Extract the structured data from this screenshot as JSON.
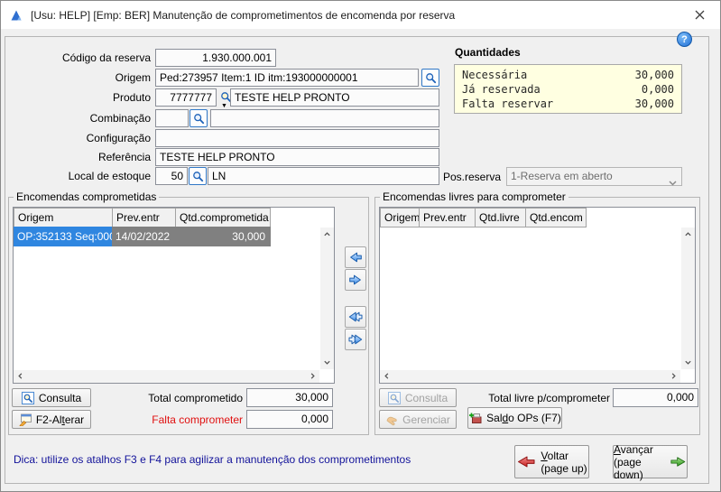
{
  "window": {
    "title": "[Usu: HELP] [Emp: BER] Manutenção de comprometimentos de encomenda por reserva",
    "help_glyph": "?"
  },
  "form": {
    "codigo": {
      "label": "Código da reserva",
      "value": "1.930.000.001"
    },
    "origem": {
      "label": "Origem",
      "value": "Ped:273957 Item:1 ID itm:193000000001"
    },
    "produto": {
      "label": "Produto",
      "code": "7777777",
      "desc": "TESTE HELP PRONTO",
      "dropdown_glyph": "▼"
    },
    "combinacao": {
      "label": "Combinação",
      "code": "",
      "desc": ""
    },
    "configuracao": {
      "label": "Configuração",
      "value": ""
    },
    "referencia": {
      "label": "Referência",
      "value": "TESTE HELP PRONTO"
    },
    "local": {
      "label": "Local de estoque",
      "code": "50",
      "desc": "LN"
    },
    "pos_reserva": {
      "label": "Pos.reserva",
      "value": "1-Reserva em aberto"
    }
  },
  "quantidades": {
    "title": "Quantidades",
    "rows": [
      {
        "label": "Necessária",
        "value": "30,000"
      },
      {
        "label": "Já reservada",
        "value": "0,000"
      },
      {
        "label": "Falta reservar",
        "value": "30,000"
      }
    ]
  },
  "committed": {
    "title": "Encomendas comprometidas",
    "columns": [
      "Origem",
      "Prev.entr",
      "Qtd.comprometida"
    ],
    "row": {
      "origem": "OP:352133 Seq:000",
      "prev_entr": "14/02/2022",
      "qtd": "30,000"
    },
    "consulta": "Consulta",
    "alterar": "F2-Alterar",
    "total_label": "Total comprometido",
    "total_value": "30,000",
    "falta_label": "Falta comprometer",
    "falta_value": "0,000"
  },
  "free": {
    "title": "Encomendas livres para comprometer",
    "columns": [
      "Origem",
      "Prev.entr",
      "Qtd.livre",
      "Qtd.encom"
    ],
    "consulta": "Consulta",
    "gerenciar": "Gerenciar",
    "saldo_ops": "Saldo OPs (F7)",
    "total_label": "Total livre p/comprometer",
    "total_value": "0,000"
  },
  "footer": {
    "hint": "Dica: utilize os atalhos F3 e F4 para agilizar a manutenção dos comprometimentos",
    "voltar_line1": "Voltar",
    "voltar_line2": "(page up)",
    "avancar_line1": "Avançar",
    "avancar_line2": "(page down)"
  },
  "colors": {
    "selection_blue": "#2f86e0",
    "row_gray": "#808080",
    "falta_red": "#e01010",
    "hint_navy": "#12129a",
    "quantidades_bg": "#ffffe1"
  }
}
